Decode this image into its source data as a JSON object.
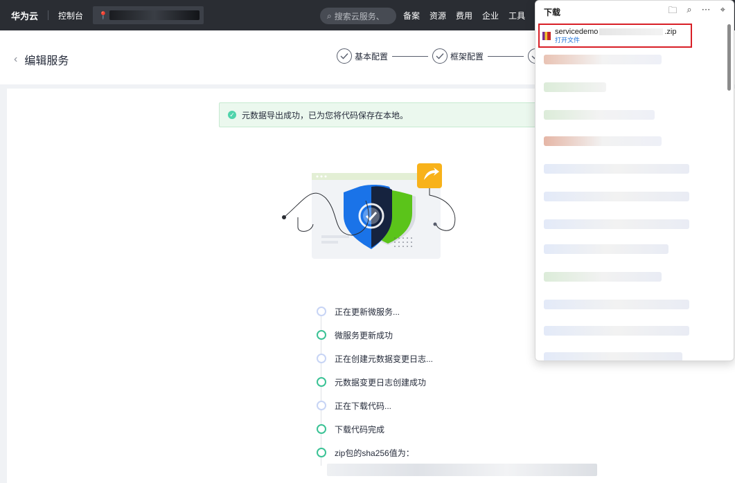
{
  "topnav": {
    "brand": "华为云",
    "console": "控制台",
    "search_placeholder": "搜索云服务、",
    "menu": [
      "备案",
      "资源",
      "费用",
      "企业",
      "工具"
    ]
  },
  "page": {
    "title": "编辑服务",
    "steps": [
      "基本配置",
      "框架配置"
    ]
  },
  "alert": {
    "text": "元数据导出成功，已为您将代码保存在本地。"
  },
  "timeline": [
    {
      "label": "正在更新微服务...",
      "status": "pending"
    },
    {
      "label": "微服务更新成功",
      "status": "done"
    },
    {
      "label": "正在创建元数据变更日志...",
      "status": "pending"
    },
    {
      "label": "元数据变更日志创建成功",
      "status": "done"
    },
    {
      "label": "正在下载代码...",
      "status": "pending"
    },
    {
      "label": "下载代码完成",
      "status": "done"
    },
    {
      "label": "zip包的sha256值为：",
      "status": "done"
    }
  ],
  "downloads": {
    "title": "下载",
    "item": {
      "name_prefix": "servicedemo",
      "name_suffix": ".zip",
      "open_label": "打开文件"
    }
  },
  "colors": {
    "nav_bg": "#2a2d33",
    "success": "#3ac295",
    "highlight_border": "#d81e26",
    "link": "#1a6fd8"
  }
}
